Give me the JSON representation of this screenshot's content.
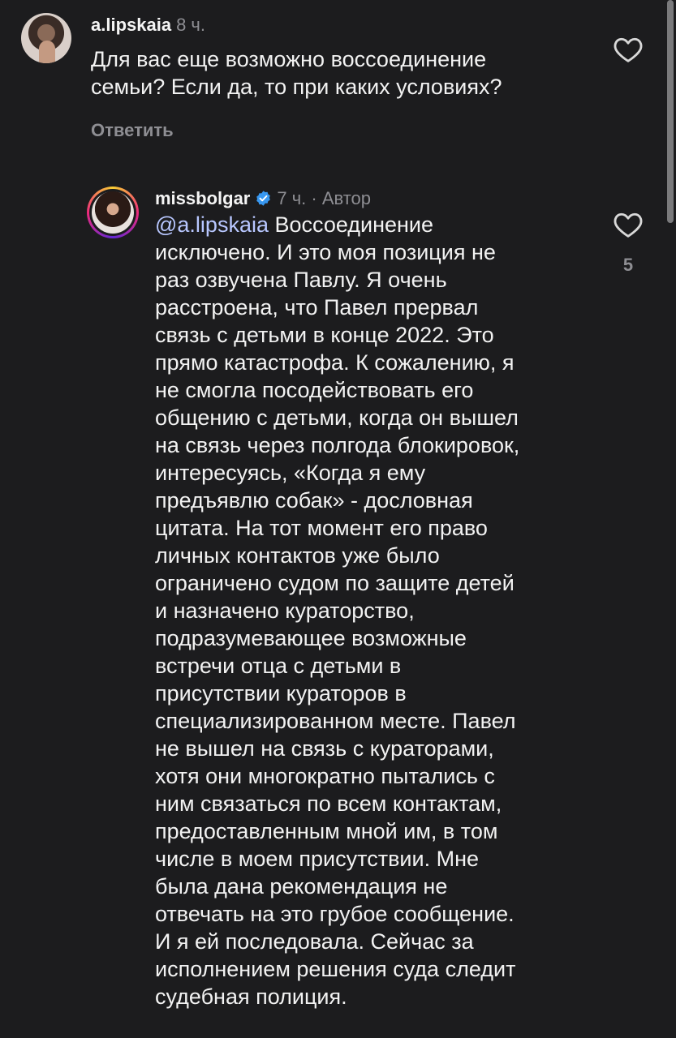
{
  "comment1": {
    "username": "a.lipskaia",
    "time": "8 ч.",
    "text": "Для вас еще возможно воссоединение\nсемьи? Если да, то при каких условиях?",
    "reply_label": "Ответить"
  },
  "comment2": {
    "username": "missbolgar",
    "time": "7 ч. · Автор",
    "mention": "@a.lipskaia",
    "text": " Воссоединение\nисключено. И это моя позиция не\nраз озвучена Павлу. Я очень\nрасстроена, что Павел прервал\nсвязь с детьми в конце 2022. Это\nпрямо катастрофа. К сожалению, я\nне смогла посодействовать его\nобщению с детьми, когда он вышел\nна связь через полгода блокировок,\nинтересуясь, «Когда я ему\nпредъявлю собак» - дословная\nцитата. На тот момент его право\nличных контактов уже было\nограничено судом по защите детей\nи назначено кураторство,\nподразумевающее возможные\nвстречи отца с детьми в\nприсутствии кураторов в\nспециализированном месте. Павел\nне вышел на связь с кураторами,\nхотя они многократно пытались с\nним связаться по всем контактам,\nпредоставленным мной им, в том\nчисле в моем присутствии. Мне\nбыла дана рекомендация не\nотвечать на это грубое сообщение.\nИ я ей последовала. Сейчас за\nисполнением решения суда следит\nсудебная полиция.",
    "like_count": "5"
  },
  "colors": {
    "background": "#1c1c1e",
    "mention": "#b8c7ff",
    "verified": "#3797f0"
  },
  "icons": {
    "like": "heart-outline-icon",
    "verified": "verified-badge-icon"
  }
}
